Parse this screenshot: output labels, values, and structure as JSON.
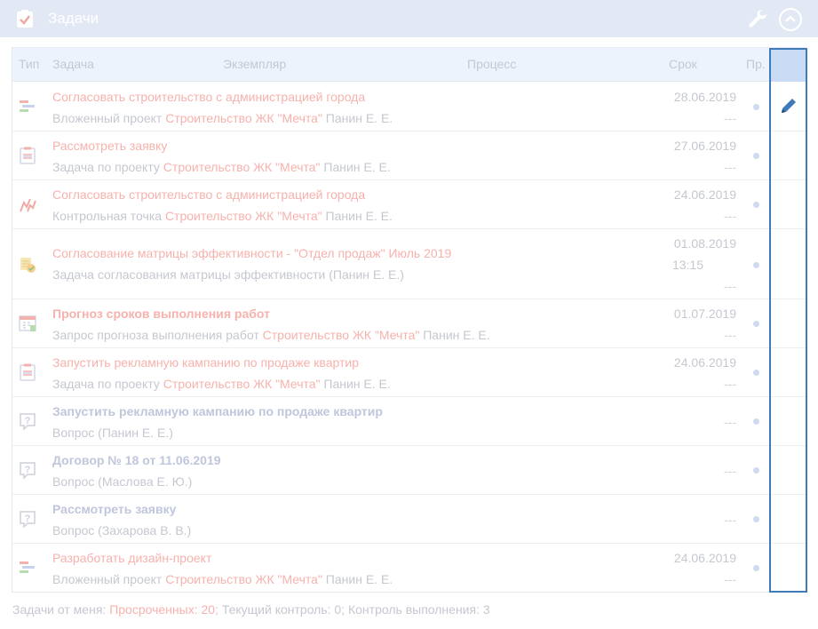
{
  "header": {
    "title": "Задачи",
    "colors": {
      "bg": "#e3e8f5",
      "accent": "#3e7bb8",
      "overdue": "#f7b2ad"
    }
  },
  "columns": {
    "type": "Тип",
    "task": "Задача",
    "instance": "Экземпляр",
    "process": "Процесс",
    "deadline": "Срок",
    "priority": "Пр."
  },
  "rows": [
    {
      "icon": "nested-project-icon",
      "title": "Согласовать строительство с администрацией города",
      "pre": "Вложенный проект ",
      "link": "Строительство ЖК \"Мечта\"",
      "post": " Панин Е. Е.",
      "date": "28.06.2019",
      "time": "",
      "dash": "---"
    },
    {
      "icon": "project-task-icon",
      "title": "Рассмотреть заявку",
      "pre": "Задача по проекту ",
      "link": "Строительство ЖК \"Мечта\"",
      "post": " Панин Е. Е.",
      "date": "27.06.2019",
      "time": "",
      "dash": "---"
    },
    {
      "icon": "checkpoint-icon",
      "title": "Согласовать строительство с администрацией города",
      "pre": "Контрольная точка ",
      "link": "Строительство ЖК \"Мечта\"",
      "post": " Панин Е. Е.",
      "date": "24.06.2019",
      "time": "",
      "dash": "---"
    },
    {
      "icon": "matrix-approval-icon",
      "title": "Согласование матрицы эффективности - \"Отдел продаж\" Июль 2019",
      "pre": "Задача согласования матрицы эффективности (Панин Е. Е.)",
      "link": "",
      "post": "",
      "date": "01.08.2019",
      "time": "13:15",
      "dash": "---"
    },
    {
      "icon": "forecast-icon",
      "title": "Прогноз сроков выполнения работ",
      "pre": "Запрос прогноза выполнения работ ",
      "link": "Строительство ЖК \"Мечта\"",
      "post": " Панин Е. Е.",
      "date": "01.07.2019",
      "time": "",
      "dash": "---"
    },
    {
      "icon": "project-task-icon",
      "title": "Запустить рекламную кампанию по продаже квартир",
      "pre": "Задача по проекту ",
      "link": "Строительство ЖК \"Мечта\"",
      "post": " Панин Е. Е.",
      "date": "24.06.2019",
      "time": "",
      "dash": "---"
    },
    {
      "icon": "question-icon",
      "title": "Запустить рекламную кампанию по продаже квартир",
      "pre": "Вопрос (Панин Е. Е.)",
      "link": "",
      "post": "",
      "date": "",
      "time": "",
      "dash": "---"
    },
    {
      "icon": "question-icon",
      "title": "Договор № 18 от 11.06.2019",
      "pre": "Вопрос (Маслова Е. Ю.)",
      "link": "",
      "post": "",
      "date": "",
      "time": "",
      "dash": "---"
    },
    {
      "icon": "question-icon",
      "title": "Рассмотреть заявку",
      "pre": "Вопрос (Захарова В. В.)",
      "link": "",
      "post": "",
      "date": "",
      "time": "",
      "dash": "---"
    },
    {
      "icon": "nested-project-icon",
      "title": "Разработать дизайн-проект",
      "pre": "Вложенный проект ",
      "link": "Строительство ЖК \"Мечта\"",
      "post": " Панин Е. Е.",
      "date": "24.06.2019",
      "time": "",
      "dash": "---"
    }
  ],
  "footer": {
    "prefix": "Задачи от меня: ",
    "overdue": "Просроченных: 20",
    "rest": "; Текущий контроль: 0; Контроль выполнения: 3"
  }
}
